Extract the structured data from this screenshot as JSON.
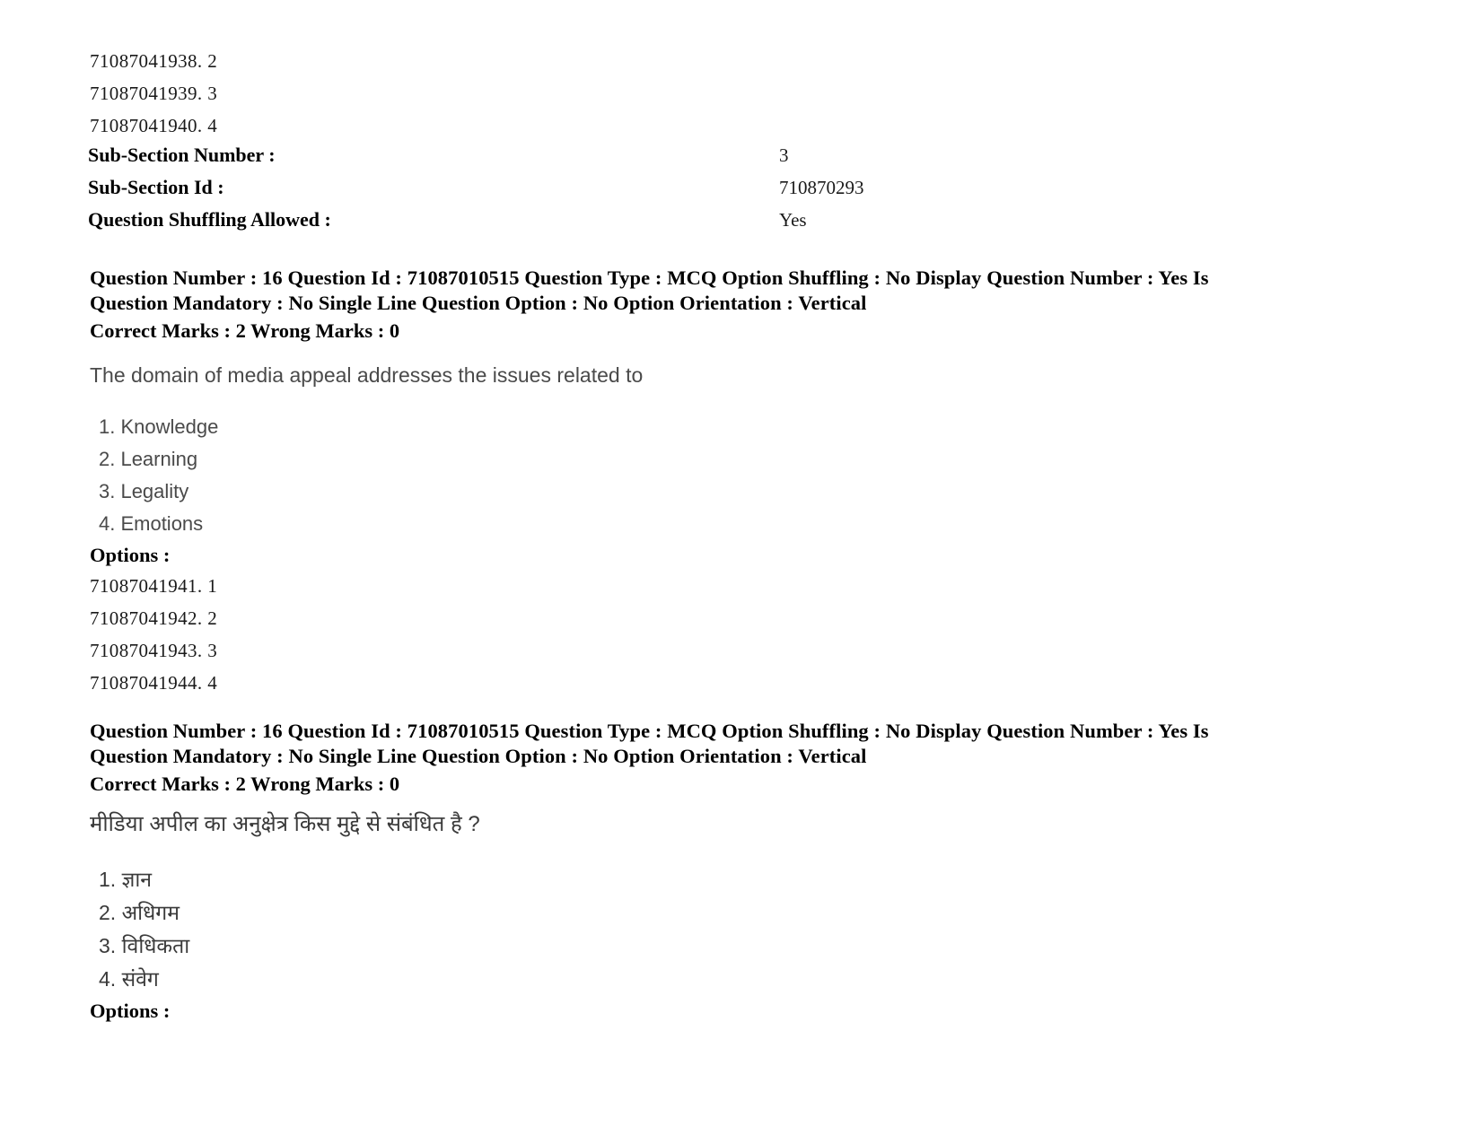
{
  "document": {
    "type": "exam-question-paper"
  },
  "top_option_ids": [
    "71087041938. 2",
    "71087041939. 3",
    "71087041940. 4"
  ],
  "subsection_meta": [
    {
      "label": "Sub-Section Number :",
      "value": "3"
    },
    {
      "label": "Sub-Section Id :",
      "value": "710870293"
    },
    {
      "label": "Question Shuffling Allowed :",
      "value": "Yes"
    }
  ],
  "questions": [
    {
      "header_line1": "Question Number : 16 Question Id : 71087010515 Question Type : MCQ Option Shuffling : No Display Question Number : Yes Is",
      "header_line2": "Question Mandatory : No Single Line Question Option : No Option Orientation : Vertical",
      "marks_line": "Correct Marks : 2 Wrong Marks : 0",
      "text": "The domain of media appeal addresses the issues related to",
      "choices": [
        "1. Knowledge",
        "2. Learning",
        "3. Legality",
        "4. Emotions"
      ],
      "options_label": "Options :",
      "option_ids": [
        "71087041941. 1",
        "71087041942. 2",
        "71087041943. 3",
        "71087041944. 4"
      ]
    },
    {
      "header_line1": "Question Number : 16 Question Id : 71087010515 Question Type : MCQ Option Shuffling : No Display Question Number : Yes Is",
      "header_line2": "Question Mandatory : No Single Line Question Option : No Option Orientation : Vertical",
      "marks_line": "Correct Marks : 2 Wrong Marks : 0",
      "text": "मीडिया अपील का अनुक्षेत्र किस मुद्दे से संबंधित है ?",
      "choices": [
        "1. ज्ञान",
        "2. अधिगम",
        "3. विधिकता",
        "4. संवेग"
      ],
      "options_label": "Options :",
      "option_ids": []
    }
  ]
}
